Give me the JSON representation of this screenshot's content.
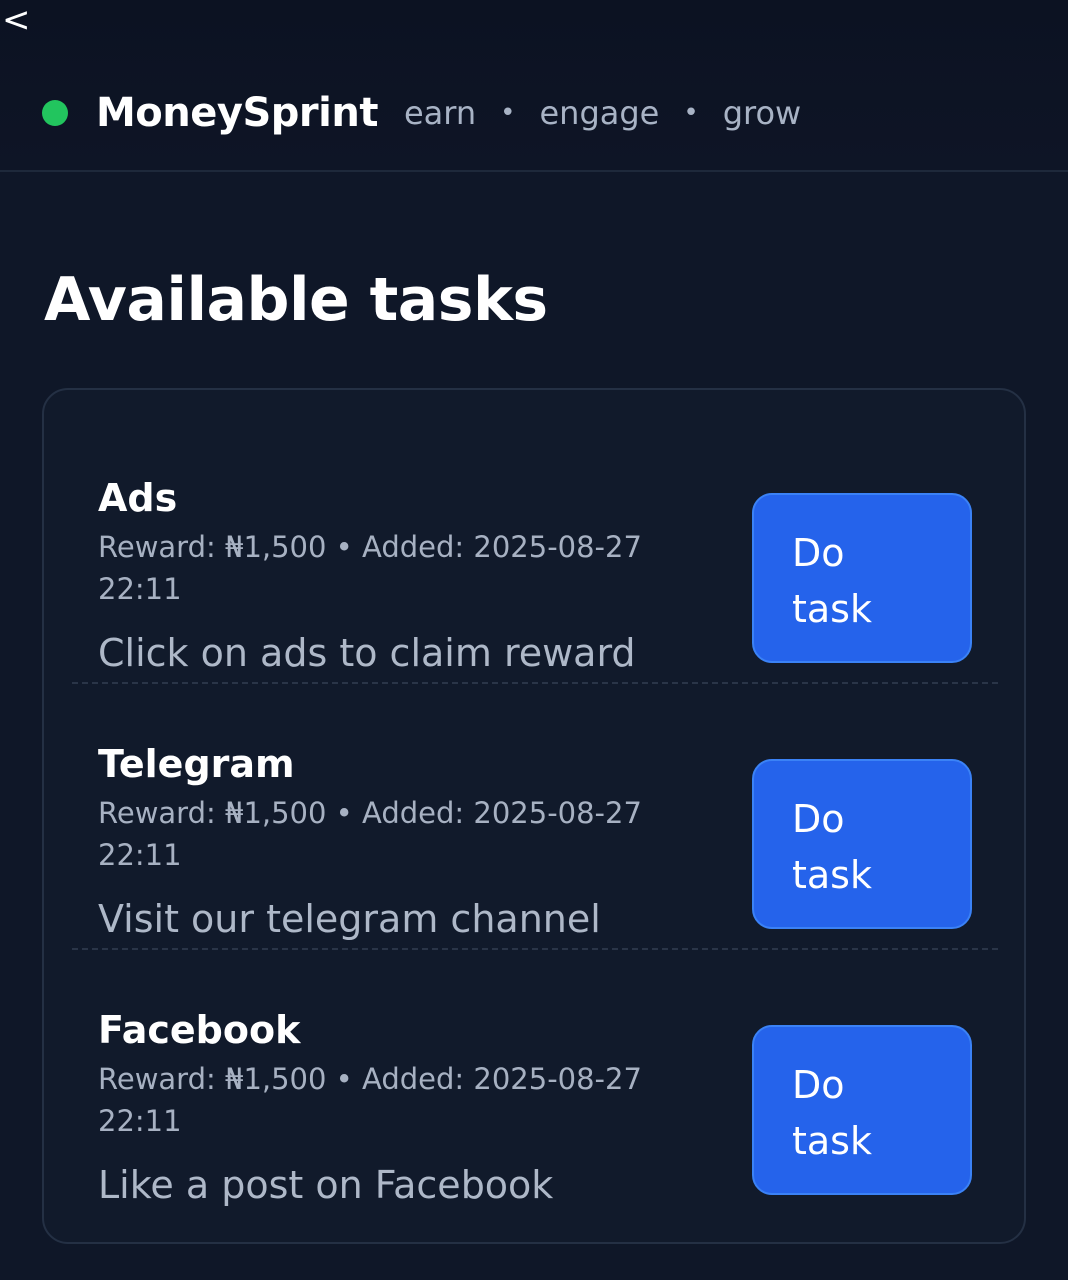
{
  "header": {
    "back_label": "<",
    "brand": "MoneySprint",
    "tagline": [
      "earn",
      "engage",
      "grow"
    ],
    "separator": "•",
    "status_color": "#22c55e"
  },
  "main": {
    "title": "Available tasks",
    "tasks": [
      {
        "name": "Ads",
        "meta": "Reward: ₦1,500 • Added: 2025-08-27 22:11",
        "description": "Click on ads to claim reward",
        "button_label": "Do task"
      },
      {
        "name": "Telegram",
        "meta": "Reward: ₦1,500 • Added: 2025-08-27 22:11",
        "description": "Visit our telegram channel",
        "button_label": "Do task"
      },
      {
        "name": "Facebook",
        "meta": "Reward: ₦1,500 • Added: 2025-08-27 22:11",
        "description": "Like a post on Facebook",
        "button_label": "Do task"
      }
    ]
  },
  "colors": {
    "background": "#0f1728",
    "accent_button": "#2563eb",
    "status_dot": "#22c55e"
  }
}
